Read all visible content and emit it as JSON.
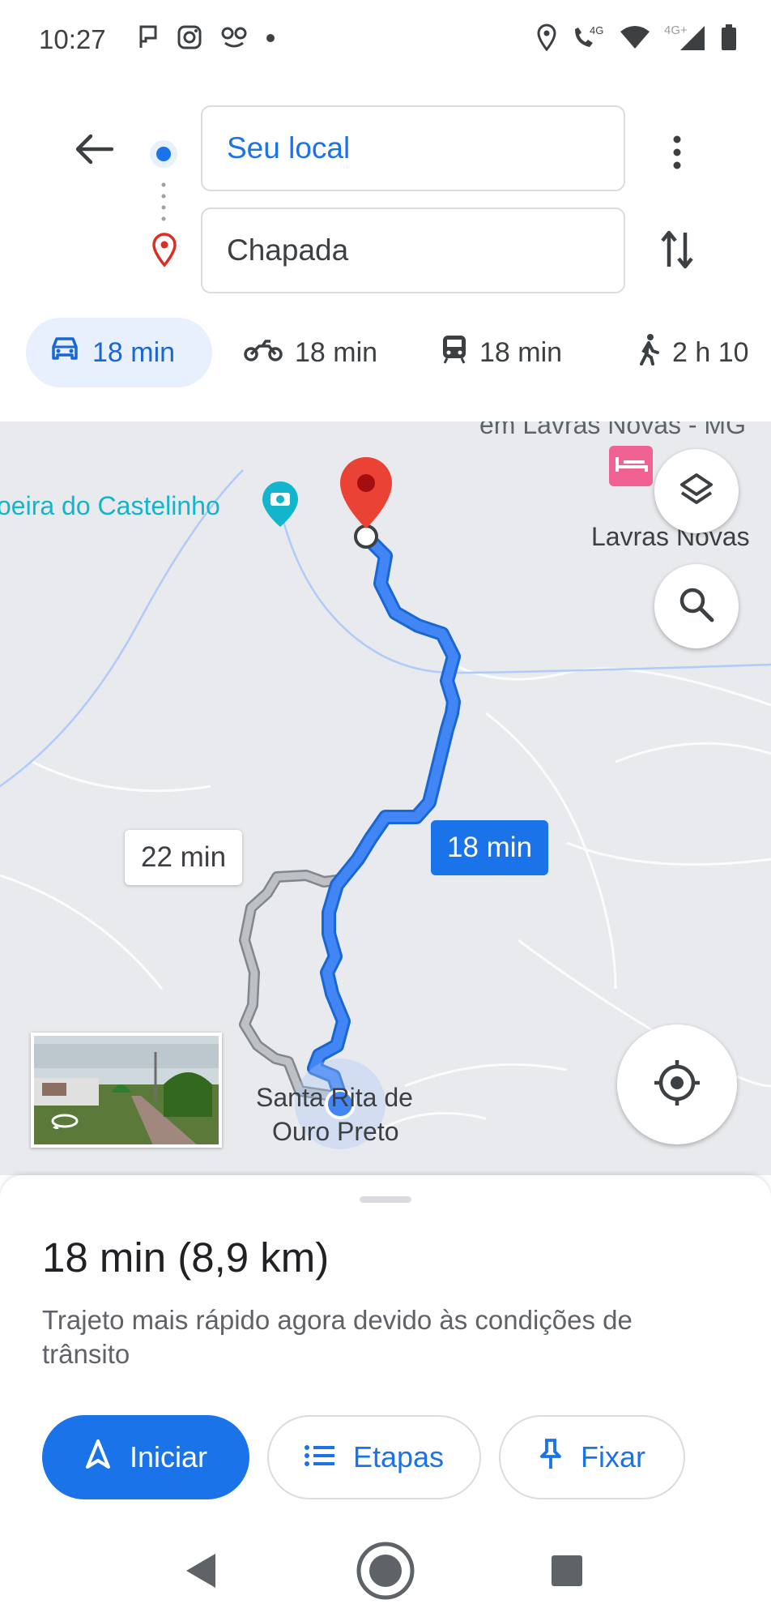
{
  "status_bar": {
    "time": "10:27",
    "network_primary": "4G",
    "network_secondary": "4G+",
    "left_icons": [
      "flag-icon",
      "instagram-icon",
      "voicemail-icon",
      "dot-icon"
    ],
    "right_icons": [
      "location-icon",
      "call-4g-icon",
      "wifi-icon",
      "signal-icon",
      "battery-icon"
    ]
  },
  "directions": {
    "origin": "Seu local",
    "destination": "Chapada"
  },
  "modes": [
    {
      "icon": "car-icon",
      "label": "18 min",
      "active": true
    },
    {
      "icon": "motorcycle-icon",
      "label": "18 min",
      "active": false
    },
    {
      "icon": "transit-icon",
      "label": "18 min",
      "active": false
    },
    {
      "icon": "walk-icon",
      "label": "2 h 10",
      "active": false
    }
  ],
  "map": {
    "labels": {
      "top_partial": "em Lavras Novas - MG",
      "poi": "oeira do Castelinho",
      "town_right": "Lavras Novas",
      "town_line1": "Santa Rita de",
      "town_line2": "Ouro Preto"
    },
    "route_primary_time": "18 min",
    "route_alt_time": "22 min",
    "colors": {
      "route": "#4285f4",
      "route_border": "#1967d2",
      "alt_route": "#a8abaf",
      "destination_pin": "#ea4335",
      "map_bg": "#e8eaed"
    }
  },
  "sheet": {
    "summary": "18 min (8,9 km)",
    "reason": "Trajeto mais rápido agora devido às condições de trânsito",
    "buttons": {
      "start": "Iniciar",
      "steps": "Etapas",
      "pin": "Fixar"
    }
  }
}
